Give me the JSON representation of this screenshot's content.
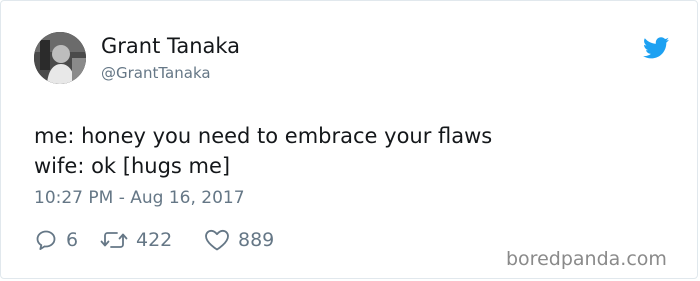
{
  "tweet": {
    "author_name": "Grant Tanaka",
    "author_handle": "@GrantTanaka",
    "text_line1": "me: honey you need to embrace your flaws",
    "text_line2": "wife: ok [hugs me]",
    "timestamp": "10:27 PM - Aug 16, 2017",
    "replies": "6",
    "retweets": "422",
    "likes": "889"
  },
  "watermark": "boredpanda.com",
  "colors": {
    "twitter_blue": "#1da1f2",
    "muted_text": "#657786",
    "border": "#e1e8ed"
  },
  "icons": [
    "twitter-bird-icon",
    "reply-icon",
    "retweet-icon",
    "like-icon"
  ]
}
